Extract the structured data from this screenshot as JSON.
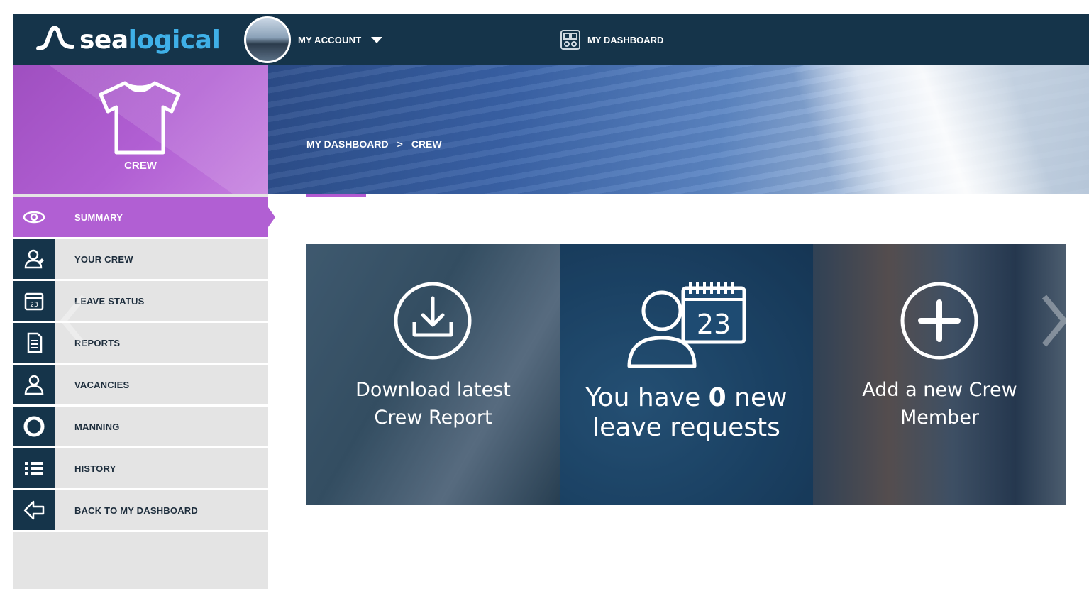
{
  "brand": {
    "name_part1": "sea",
    "name_part2": "logical"
  },
  "topbar": {
    "account_label": "MY ACCOUNT",
    "dashboard_label": "MY DASHBOARD"
  },
  "breadcrumb": {
    "items": [
      "MY DASHBOARD",
      "CREW"
    ],
    "separator": ">"
  },
  "section": {
    "title": "CREW",
    "icon": "tshirt-icon"
  },
  "nav": {
    "items": [
      {
        "label": "SUMMARY",
        "icon": "eye-icon",
        "active": true
      },
      {
        "label": "YOUR CREW",
        "icon": "crew-member-icon"
      },
      {
        "label": "LEAVE STATUS",
        "icon": "calendar-icon"
      },
      {
        "label": "REPORTS",
        "icon": "document-icon"
      },
      {
        "label": "VACANCIES",
        "icon": "person-icon"
      },
      {
        "label": "MANNING",
        "icon": "lifebuoy-icon"
      },
      {
        "label": "HISTORY",
        "icon": "list-icon"
      },
      {
        "label": "BACK TO MY DASHBOARD",
        "icon": "back-arrow-icon"
      }
    ]
  },
  "cards": {
    "download": {
      "line1": "Download latest",
      "line2": "Crew Report",
      "icon": "download-icon"
    },
    "leave": {
      "prefix": "You have ",
      "count": "0",
      "suffix": " new",
      "line2": "leave requests",
      "calendar_number": "23",
      "icon": "person-calendar-icon"
    },
    "add": {
      "line1": "Add a new Crew",
      "line2": "Member",
      "icon": "plus-circle-icon"
    }
  },
  "colors": {
    "topbar": "#15344a",
    "accent_purple": "#b15fd3",
    "brand_blue": "#3fb0e8",
    "sidebar_bg": "#e4e4e4"
  }
}
